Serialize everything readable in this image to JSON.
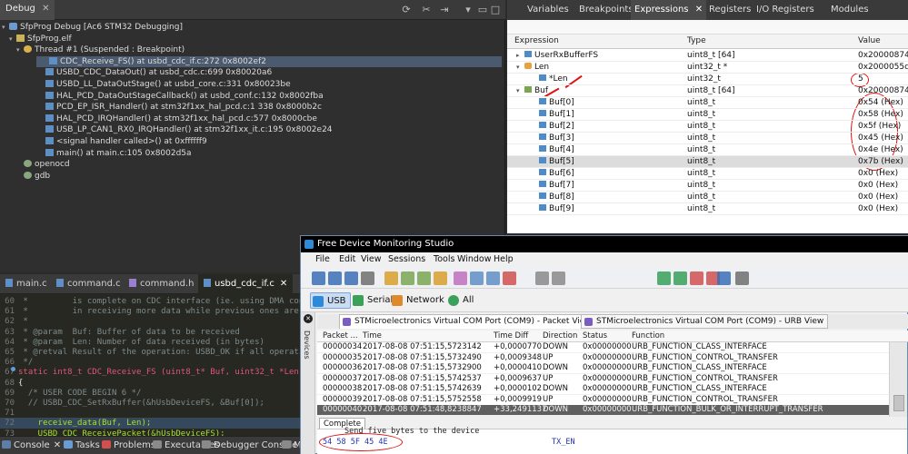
{
  "debug": {
    "tab": "Debug",
    "tree": [
      {
        "label": "SfpProg Debug [Ac6 STM32 Debugging]",
        "icon": "bug"
      },
      {
        "label": "SfpProg.elf",
        "icon": "file"
      },
      {
        "label": "Thread #1 (Suspended : Breakpoint)",
        "icon": "thread"
      },
      {
        "label": "CDC_Receive_FS() at usbd_cdc_if.c:272 0x8002ef2",
        "icon": "frame",
        "selected": true
      },
      {
        "label": "USBD_CDC_DataOut() at usbd_cdc.c:699 0x80020a6",
        "icon": "frame"
      },
      {
        "label": "USBD_LL_DataOutStage() at usbd_core.c:331 0x80023be",
        "icon": "frame"
      },
      {
        "label": "HAL_PCD_DataOutStageCallback() at usbd_conf.c:132 0x8002fba",
        "icon": "frame"
      },
      {
        "label": "PCD_EP_ISR_Handler() at stm32f1xx_hal_pcd.c:1 338 0x8000b2c",
        "icon": "frame"
      },
      {
        "label": "HAL_PCD_IRQHandler() at stm32f1xx_hal_pcd.c:577 0x8000cbe",
        "icon": "frame"
      },
      {
        "label": "USB_LP_CAN1_RX0_IRQHandler() at stm32f1xx_it.c:195 0x8002e24",
        "icon": "frame"
      },
      {
        "label": "<signal handler called>() at 0xffffff9",
        "icon": "frame"
      },
      {
        "label": "main() at main.c:105 0x8002d5a",
        "icon": "frame"
      },
      {
        "label": "openocd",
        "icon": "proc"
      },
      {
        "label": "gdb",
        "icon": "proc"
      }
    ]
  },
  "expr_tabs": [
    "Variables",
    "Breakpoints",
    "Expressions",
    "Registers",
    "I/O Registers",
    "Modules"
  ],
  "expr_close": "✕",
  "expr_columns": {
    "expression": "Expression",
    "type": "Type",
    "value": "Value"
  },
  "expressions": [
    {
      "expr": "UserRxBufferFS",
      "type": "uint8_t [64]",
      "value": "0x20000874 <U",
      "icon": "var",
      "twisty": "▸"
    },
    {
      "expr": "Len",
      "type": "uint32_t *",
      "value": "0x2000055c <m",
      "icon": "ptr",
      "twisty": "▾"
    },
    {
      "expr": "*Len",
      "type": "uint32_t",
      "value": "5",
      "icon": "var",
      "twisty": ""
    },
    {
      "expr": "Buf",
      "type": "uint8_t [64]",
      "value": "0x20000874 <U",
      "icon": "arr",
      "twisty": "▾"
    },
    {
      "expr": "Buf[0]",
      "type": "uint8_t",
      "value": "0x54 (Hex)",
      "icon": "var",
      "twisty": ""
    },
    {
      "expr": "Buf[1]",
      "type": "uint8_t",
      "value": "0x58 (Hex)",
      "icon": "var",
      "twisty": ""
    },
    {
      "expr": "Buf[2]",
      "type": "uint8_t",
      "value": "0x5f (Hex)",
      "icon": "var",
      "twisty": ""
    },
    {
      "expr": "Buf[3]",
      "type": "uint8_t",
      "value": "0x45 (Hex)",
      "icon": "var",
      "twisty": ""
    },
    {
      "expr": "Buf[4]",
      "type": "uint8_t",
      "value": "0x4e (Hex)",
      "icon": "var",
      "twisty": ""
    },
    {
      "expr": "Buf[5]",
      "type": "uint8_t",
      "value": "0x7b (Hex)",
      "icon": "var",
      "twisty": "",
      "selected": true
    },
    {
      "expr": "Buf[6]",
      "type": "uint8_t",
      "value": "0x0 (Hex)",
      "icon": "var",
      "twisty": ""
    },
    {
      "expr": "Buf[7]",
      "type": "uint8_t",
      "value": "0x0 (Hex)",
      "icon": "var",
      "twisty": ""
    },
    {
      "expr": "Buf[8]",
      "type": "uint8_t",
      "value": "0x0 (Hex)",
      "icon": "var",
      "twisty": ""
    },
    {
      "expr": "Buf[9]",
      "type": "uint8_t",
      "value": "0x0 (Hex)",
      "icon": "var",
      "twisty": ""
    }
  ],
  "editor": {
    "tabs": [
      "main.c",
      "command.c",
      "command.h",
      "usbd_cdc_if.c"
    ],
    "active_tab": 3,
    "close": "✕",
    "lines": [
      {
        "n": "60",
        "cls": "cm",
        "text": " *         is complete on CDC interface (ie. using DMA controller"
      },
      {
        "n": "61",
        "cls": "cm",
        "text": " *         in receiving more data while previous ones are still"
      },
      {
        "n": "62",
        "cls": "cm",
        "text": " *"
      },
      {
        "n": "63",
        "cls": "cm",
        "text": " * @param  Buf: Buffer of data to be received"
      },
      {
        "n": "64",
        "cls": "cm",
        "text": " * @param  Len: Number of data received (in bytes)"
      },
      {
        "n": "65",
        "cls": "cm",
        "text": " * @retval Result of the operation: USBD_OK if all operations"
      },
      {
        "n": "66",
        "cls": "cm",
        "text": " */"
      },
      {
        "n": "67",
        "cls": "sig",
        "text": "static int8_t CDC_Receive_FS (uint8_t* Buf, uint32_t *Len)"
      },
      {
        "n": "68",
        "cls": "tx",
        "text": "{"
      },
      {
        "n": "69",
        "cls": "cm",
        "text": "  /* USER CODE BEGIN 6 */"
      },
      {
        "n": "70",
        "cls": "cm",
        "text": "  // USBD_CDC_SetRxBuffer(&hUsbDeviceFS, &Buf[0]);"
      },
      {
        "n": "71",
        "cls": "tx",
        "text": ""
      },
      {
        "n": "72",
        "cls": "fnl",
        "text": "    receive_data(Buf, Len);"
      },
      {
        "n": "73",
        "cls": "fnl",
        "text": "    USBD_CDC_ReceivePacket(&hUsbDeviceFS);"
      }
    ]
  },
  "bottom_tabs": [
    {
      "label": "Console",
      "close": "✕",
      "color": "#5c7ea8"
    },
    {
      "label": "Tasks",
      "color": "#6a9bd1"
    },
    {
      "label": "Problems",
      "color": "#d05050"
    },
    {
      "label": "Executables",
      "color": "#8a8a8a"
    },
    {
      "label": "Debugger Console",
      "color": "#8a8a8a"
    },
    {
      "label": "Memory",
      "color": "#8a8a8a"
    }
  ],
  "fdms": {
    "title": "Free Device Monitoring Studio",
    "menu": [
      "File",
      "Edit",
      "View",
      "Sessions",
      "Tools",
      "Window",
      "Help"
    ],
    "modes": [
      "USB",
      "Serial",
      "Network",
      "All"
    ],
    "side_label": "Devices",
    "doc_tabs": [
      "STMicroelectronics Virtual COM Port (COM9) - Packet View",
      "STMicroelectronics Virtual COM Port (COM9) - URB View"
    ],
    "close": "✕",
    "packet_columns": [
      "Packet ...",
      "Time",
      "Time Diff",
      "Direction",
      "Status",
      "Function"
    ],
    "packets": [
      [
        "00000034",
        "2017-08-08 07:51:15,5723142",
        "+0,0000770",
        "DOWN",
        "0x00000000",
        "URB_FUNCTION_CLASS_INTERFACE"
      ],
      [
        "00000035",
        "2017-08-08 07:51:15,5732490",
        "+0,0009348",
        "UP",
        "0x00000000",
        "URB_FUNCTION_CONTROL_TRANSFER"
      ],
      [
        "00000036",
        "2017-08-08 07:51:15,5732900",
        "+0,0000410",
        "DOWN",
        "0x00000000",
        "URB_FUNCTION_CLASS_INTERFACE"
      ],
      [
        "00000037",
        "2017-08-08 07:51:15,5742537",
        "+0,0009637",
        "UP",
        "0x00000000",
        "URB_FUNCTION_CONTROL_TRANSFER"
      ],
      [
        "00000038",
        "2017-08-08 07:51:15,5742639",
        "+0,0000102",
        "DOWN",
        "0x00000000",
        "URB_FUNCTION_CLASS_INTERFACE"
      ],
      [
        "00000039",
        "2017-08-08 07:51:15,5752558",
        "+0,0009919",
        "UP",
        "0x00000000",
        "URB_FUNCTION_CONTROL_TRANSFER"
      ],
      [
        "00000040",
        "2017-08-08 07:51:48,8238847",
        "+33,2491137",
        "DOWN",
        "0x00000000",
        "URB_FUNCTION_BULK_OR_INTERRUPT_TRANSFER"
      ]
    ],
    "selected_packet": 6,
    "detail_tab": "Complete",
    "detail_caption": "Send five bytes to the device",
    "detail_hex": "54 58 5F 45 4E",
    "detail_ascii": "TX_EN"
  },
  "colors": {
    "annotation": "#e01010",
    "fdms_accent": "#2e8ad6"
  }
}
